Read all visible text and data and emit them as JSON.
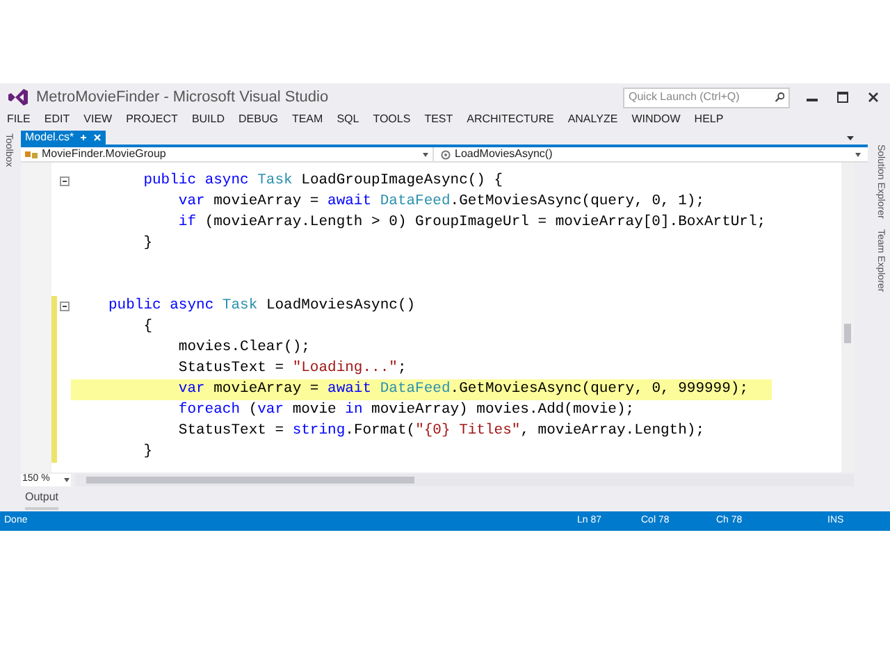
{
  "window": {
    "title": "MetroMovieFinder - Microsoft Visual Studio"
  },
  "quick_launch": {
    "placeholder": "Quick Launch (Ctrl+Q)"
  },
  "menu": [
    "FILE",
    "EDIT",
    "VIEW",
    "PROJECT",
    "BUILD",
    "DEBUG",
    "TEAM",
    "SQL",
    "TOOLS",
    "TEST",
    "ARCHITECTURE",
    "ANALYZE",
    "WINDOW",
    "HELP"
  ],
  "side_panels": {
    "left": [
      "Toolbox"
    ],
    "right": [
      "Solution Explorer",
      "Team Explorer"
    ]
  },
  "tabs": [
    {
      "label": "Model.cs*",
      "selected": true
    }
  ],
  "nav": {
    "type_scope": "MovieFinder.MovieGroup",
    "member": "LoadMoviesAsync()"
  },
  "code": [
    {
      "changed": false,
      "highlighted": false,
      "collapsible": true,
      "tokens": [
        {
          "text": "    public",
          "kind": "kw"
        },
        {
          "text": " async",
          "kind": "kw"
        },
        {
          "text": " Task",
          "kind": "type"
        },
        {
          "text": " LoadGroupImageAsync() {",
          "kind": "id"
        }
      ]
    },
    {
      "changed": false,
      "highlighted": false,
      "collapsible": false,
      "tokens": [
        {
          "text": "        var",
          "kind": "kw"
        },
        {
          "text": " movieArray = ",
          "kind": "id"
        },
        {
          "text": "await",
          "kind": "kw"
        },
        {
          "text": " DataFeed",
          "kind": "type"
        },
        {
          "text": ".GetMoviesAsync(query, 0, 1);",
          "kind": "id"
        }
      ]
    },
    {
      "changed": false,
      "highlighted": false,
      "collapsible": false,
      "tokens": [
        {
          "text": "        if",
          "kind": "kw"
        },
        {
          "text": " (movieArray.Length > 0) GroupImageUrl = movieArray[0].BoxArtUrl;",
          "kind": "id"
        }
      ]
    },
    {
      "changed": false,
      "highlighted": false,
      "collapsible": false,
      "tokens": [
        {
          "text": "    }",
          "kind": "id"
        }
      ]
    },
    {
      "changed": false,
      "highlighted": false,
      "collapsible": false
    },
    {
      "changed": false,
      "highlighted": false,
      "collapsible": false
    },
    {
      "changed": true,
      "highlighted": false,
      "collapsible": true,
      "tokens": [
        {
          "text": "public",
          "kind": "kw"
        },
        {
          "text": " async",
          "kind": "kw"
        },
        {
          "text": " Task",
          "kind": "type"
        },
        {
          "text": " LoadMoviesAsync()",
          "kind": "id"
        }
      ]
    },
    {
      "changed": true,
      "highlighted": false,
      "collapsible": false,
      "tokens": [
        {
          "text": "    {",
          "kind": "id"
        }
      ]
    },
    {
      "changed": true,
      "highlighted": false,
      "collapsible": false,
      "tokens": [
        {
          "text": "        movies.Clear();",
          "kind": "id"
        }
      ]
    },
    {
      "changed": true,
      "highlighted": false,
      "collapsible": false,
      "tokens": [
        {
          "text": "        StatusText = ",
          "kind": "id"
        },
        {
          "text": "\"Loading...\"",
          "kind": "str"
        },
        {
          "text": ";",
          "kind": "id"
        }
      ]
    },
    {
      "changed": true,
      "highlighted": true,
      "collapsible": false,
      "tokens": [
        {
          "text": "        var",
          "kind": "kw"
        },
        {
          "text": " movieArray = ",
          "kind": "id"
        },
        {
          "text": "await",
          "kind": "kw"
        },
        {
          "text": " DataFeed",
          "kind": "type"
        },
        {
          "text": ".GetMoviesAsync(query, 0, 999999);",
          "kind": "id"
        }
      ]
    },
    {
      "changed": true,
      "highlighted": false,
      "collapsible": false,
      "tokens": [
        {
          "text": "        foreach",
          "kind": "kw"
        },
        {
          "text": " (",
          "kind": "id"
        },
        {
          "text": "var",
          "kind": "kw"
        },
        {
          "text": " movie ",
          "kind": "id"
        },
        {
          "text": "in",
          "kind": "kw"
        },
        {
          "text": " movieArray) movies.Add(movie);",
          "kind": "id"
        }
      ]
    },
    {
      "changed": true,
      "highlighted": false,
      "collapsible": false,
      "tokens": [
        {
          "text": "        StatusText = ",
          "kind": "id"
        },
        {
          "text": "string",
          "kind": "kw"
        },
        {
          "text": ".Format(",
          "kind": "id"
        },
        {
          "text": "\"{0} Titles\"",
          "kind": "str"
        },
        {
          "text": ", movieArray.Length);",
          "kind": "id"
        }
      ]
    },
    {
      "changed": true,
      "highlighted": false,
      "collapsible": false,
      "tokens": [
        {
          "text": "    }",
          "kind": "id"
        }
      ]
    }
  ],
  "zoom": "150 %",
  "bottom_tabs": [
    "Output"
  ],
  "status_bar": {
    "message": "Done",
    "items": [
      "Ln 87",
      "Col 78",
      "Ch 78",
      "INS"
    ]
  }
}
